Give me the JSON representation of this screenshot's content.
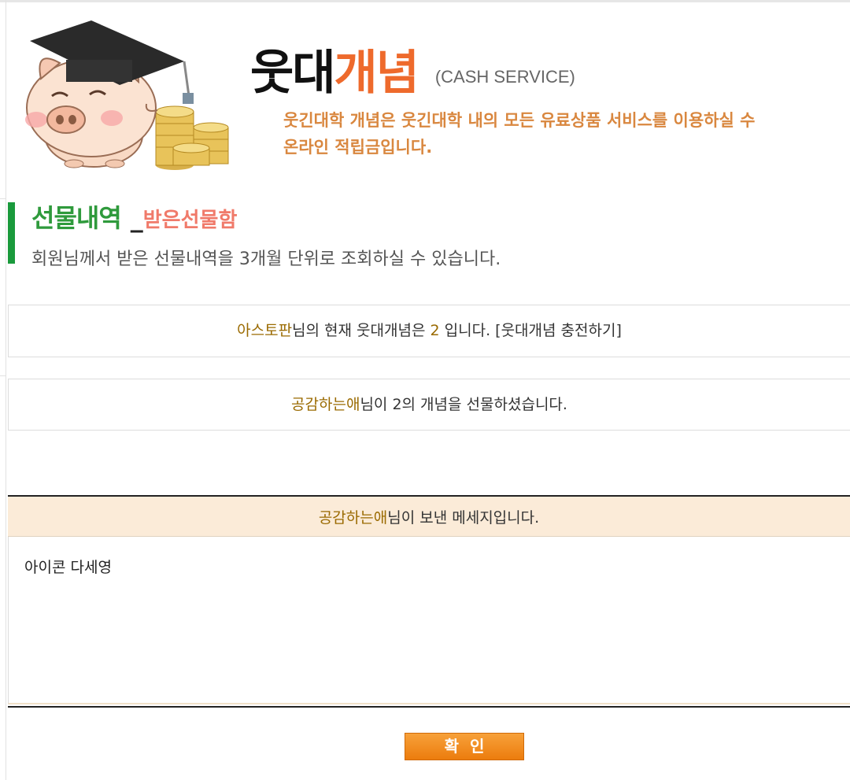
{
  "header": {
    "title_black": "웃대",
    "title_orange": "개념",
    "title_sub": "(CASH SERVICE)",
    "desc_line1": "웃긴대학 개념은 웃긴대학 내의 모든 유료상품 서비스를 이용하실 수",
    "desc_line2": "온라인 적립금입니다.",
    "mascot_icon": "pig-graduate-with-coins-icon"
  },
  "section": {
    "title": "선물내역",
    "separator": "_",
    "subtitle": "받은선물함",
    "description": "회원님께서 받은 선물내역을 3개월 단위로 조회하실 수 있습니다."
  },
  "balance": {
    "nickname": "아스토판",
    "text_before": "님의 현재 웃대개념은 ",
    "amount": "2",
    "text_after": " 입니다. ",
    "charge_link": "[웃대개념 충전하기]"
  },
  "gift": {
    "sender": "공감하는애",
    "text": "님이 2의 개념을 선물하셨습니다."
  },
  "message": {
    "sender": "공감하는애",
    "header_text": "님이 보낸 메세지입니다.",
    "content": "아이콘 다세영"
  },
  "confirm_button": {
    "label": "확인"
  },
  "colors": {
    "accent_orange": "#ee6a2c",
    "section_green": "#2f9a3c",
    "nickname_gold": "#9a6a00",
    "message_header_bg": "#fbebd8",
    "button_orange": "#ec7c0d"
  }
}
